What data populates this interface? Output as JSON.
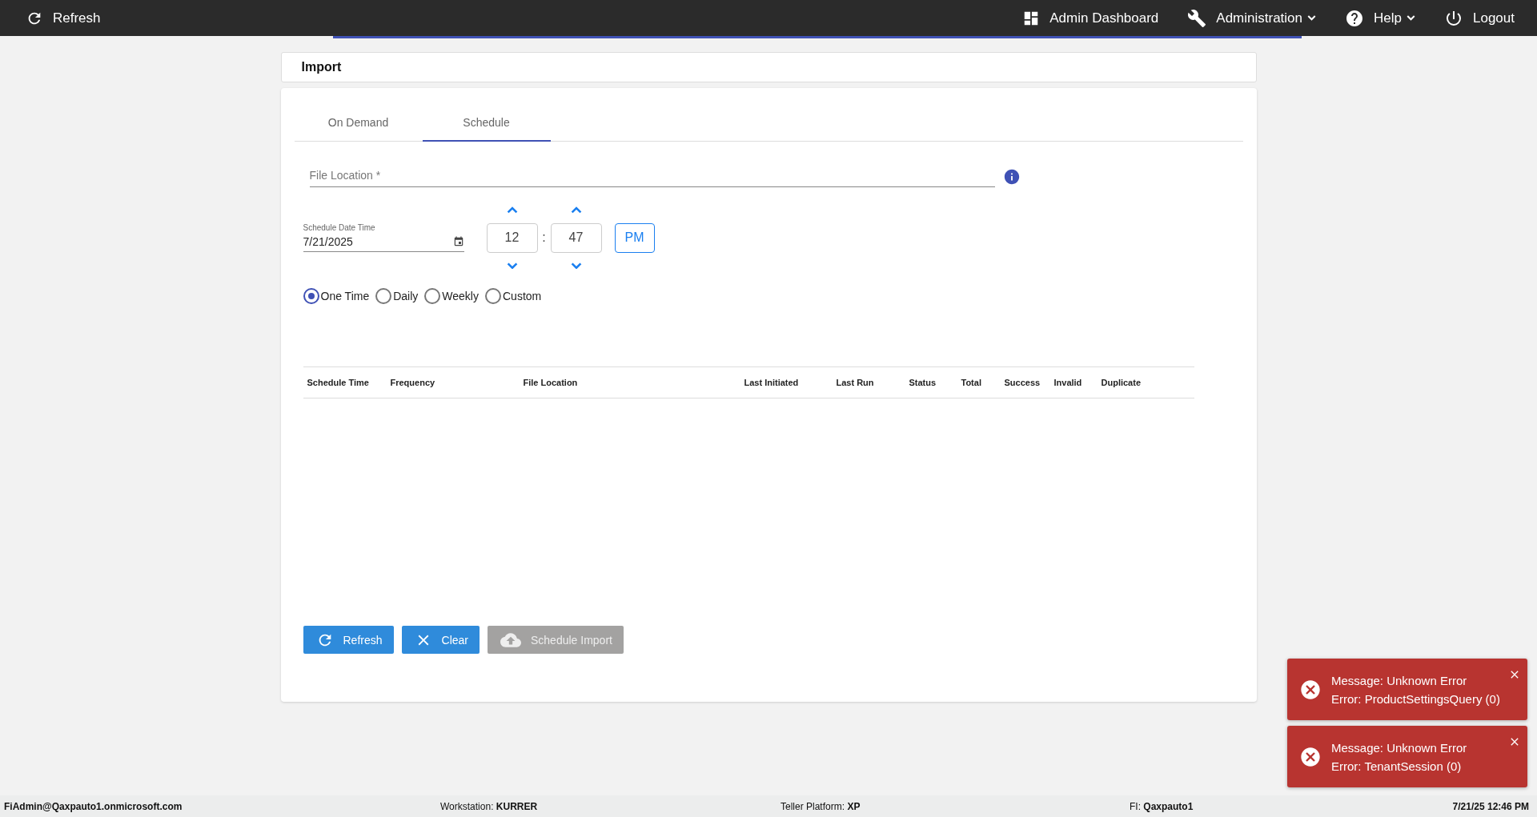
{
  "top_bar": {
    "refresh": "Refresh",
    "items": [
      {
        "kind": "dashboard",
        "label": "Admin Dashboard",
        "dropdown": false
      },
      {
        "kind": "tools",
        "label": "Administration",
        "dropdown": true
      },
      {
        "kind": "help",
        "label": "Help",
        "dropdown": true
      },
      {
        "kind": "logout",
        "label": "Logout",
        "dropdown": false
      }
    ]
  },
  "page_title": "Import",
  "tabs": [
    {
      "label": "On Demand",
      "selected": false
    },
    {
      "label": "Schedule",
      "selected": true
    }
  ],
  "file_location": {
    "placeholder": "File Location *"
  },
  "schedule": {
    "label": "Schedule Date Time",
    "date": "7/21/2025",
    "hour": "12",
    "separator": ":",
    "minute": "47",
    "meridiem": "PM"
  },
  "frequency": [
    {
      "label": "One Time",
      "selected": true
    },
    {
      "label": "Daily",
      "selected": false
    },
    {
      "label": "Weekly",
      "selected": false
    },
    {
      "label": "Custom",
      "selected": false
    }
  ],
  "table": {
    "columns": [
      "Schedule Time",
      "Frequency",
      "File Location",
      "Last Initiated",
      "Last Run",
      "Status",
      "Total",
      "Success",
      "Invalid",
      "Duplicate"
    ]
  },
  "buttons": [
    {
      "kind": "refresh",
      "label": "Refresh",
      "disabled": false
    },
    {
      "kind": "clear",
      "label": "Clear",
      "disabled": false
    },
    {
      "kind": "upload",
      "label": "Schedule Import",
      "disabled": true
    }
  ],
  "toasts": [
    {
      "message": "Message: Unknown Error",
      "error": "Error: ProductSettingsQuery (0)"
    },
    {
      "message": "Message: Unknown Error",
      "error": "Error: TenantSession (0)"
    }
  ],
  "status_bar": {
    "user": "FiAdmin@Qaxpauto1.onmicrosoft.com",
    "workstation_label": "Workstation:",
    "workstation": "KURRER",
    "platform_label": "Teller Platform:",
    "platform": "XP",
    "fi_label": "FI:",
    "fi": "Qaxpauto1",
    "datetime": "7/21/25 12:46 PM"
  }
}
